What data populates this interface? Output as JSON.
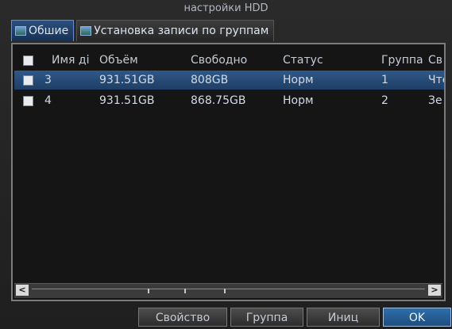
{
  "window": {
    "title": "настройки HDD"
  },
  "tabs": [
    {
      "label": "Обшие",
      "icon": "picture-icon"
    },
    {
      "label": "Установка записи по группам",
      "icon": "picture-icon"
    }
  ],
  "table": {
    "columns": [
      "Имя ді",
      "Объём",
      "Свободно",
      "Статус",
      "Группа",
      "Св"
    ],
    "rows": [
      {
        "name": "3",
        "capacity": "931.51GB",
        "free": "808GB",
        "status": "Норм",
        "group": "1",
        "prop": "Чте",
        "selected": true
      },
      {
        "name": "4",
        "capacity": "931.51GB",
        "free": "868.75GB",
        "status": "Норм",
        "group": "2",
        "prop": "Зе",
        "selected": false
      }
    ]
  },
  "scrollbar": {
    "left_icon": "arrow-left-icon",
    "right_icon": "arrow-right-icon",
    "left_glyph": "<",
    "right_glyph": ">"
  },
  "buttons": {
    "property": "Свойство",
    "group": "Группа",
    "init": "Иниц",
    "ok": "OK"
  },
  "colors": {
    "selected_row": "#2f5888",
    "accent": "#2f6ea9"
  }
}
